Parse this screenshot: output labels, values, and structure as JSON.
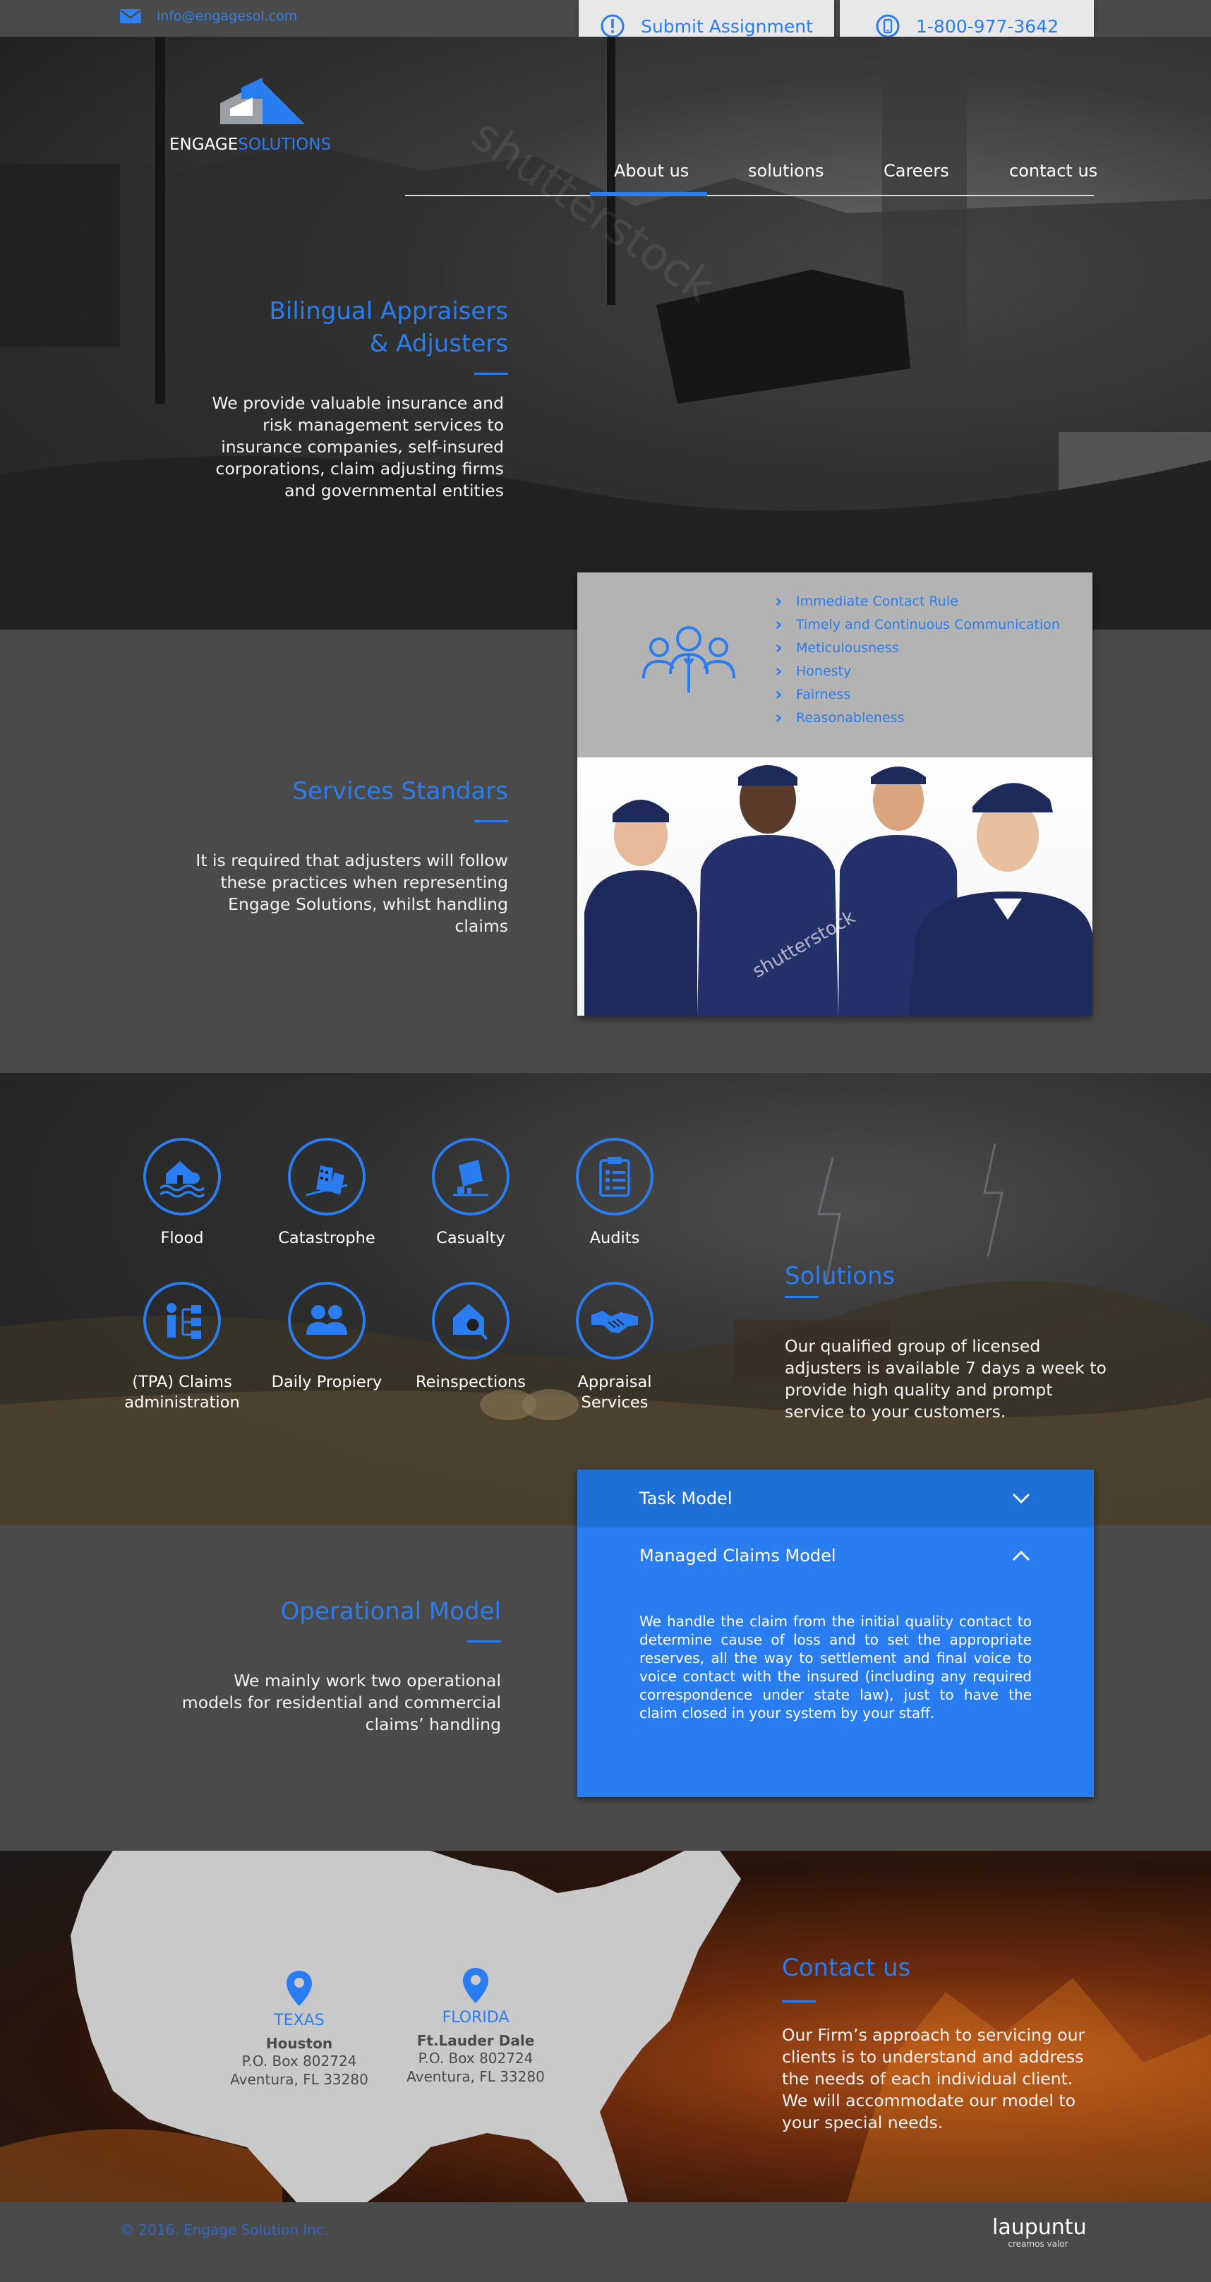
{
  "topbar": {
    "email": "info@engagesol.com",
    "submit_label": "Submit Assignment",
    "phone": "1-800-977-3642"
  },
  "brand": {
    "name_part1": "ENGAGE",
    "name_part2": "SOLUTIONS"
  },
  "nav": {
    "items": [
      {
        "label": "About us",
        "active": true
      },
      {
        "label": "solutions",
        "active": false
      },
      {
        "label": "Careers",
        "active": false
      },
      {
        "label": "contact us",
        "active": false
      }
    ]
  },
  "hero": {
    "title_line1": "Bilingual Appraisers",
    "title_line2": "& Adjusters",
    "body_lines": [
      "We provide valuable insurance and",
      "risk management services to",
      "insurance companies, self-insured",
      "corporations, claim adjusting firms",
      "and governmental entities"
    ],
    "watermark": "shutterstock"
  },
  "standards": {
    "title": "Services Standars",
    "body_lines": [
      "It is required that adjusters will follow",
      "these practices when representing",
      "Engage Solutions, whilst handling",
      "claims"
    ],
    "items": [
      "Immediate Contact Rule",
      "Timely and Continuous Communication",
      "Meticulousness",
      "Honesty",
      "Fairness",
      "Reasonableness"
    ],
    "icon": "team-icon",
    "photo_watermark": "shutterstock"
  },
  "solutions": {
    "title": "Solutions",
    "body_lines": [
      "Our qualified group of licensed",
      "adjusters is available 7 days a week to",
      "provide high quality and prompt",
      "service to your customers."
    ],
    "services": [
      {
        "label": "Flood",
        "icon": "flood-icon"
      },
      {
        "label": "Catastrophe",
        "icon": "catastrophe-icon"
      },
      {
        "label": "Casualty",
        "icon": "casualty-icon"
      },
      {
        "label": "Audits",
        "icon": "clipboard-icon"
      },
      {
        "label": "(TPA) Claims administration",
        "icon": "org-chart-icon"
      },
      {
        "label": "Daily Propiery",
        "icon": "users-icon"
      },
      {
        "label": "Reinspections",
        "icon": "house-search-icon"
      },
      {
        "label": "Appraisal Services",
        "icon": "handshake-icon"
      }
    ]
  },
  "operational": {
    "title": "Operational Model",
    "body_lines": [
      "We mainly work two operational",
      "models for residential and commercial",
      "claims’ handling"
    ],
    "accordion": {
      "task_label": "Task Model",
      "managed_label": "Managed Claims Model",
      "managed_body": "We handle the claim from the initial quality contact to determine cause of loss and to set the appropriate reserves, all the way to settlement and final voice to voice contact with the insured (including any required correspondence under state law), just to have the claim closed in your system by your staff."
    }
  },
  "contact": {
    "title": "Contact us",
    "body_lines": [
      "Our Firm’s approach to servicing our",
      "clients is to understand and address",
      "the needs of each individual client.",
      "We will accommodate our model to",
      "your special needs."
    ],
    "locations": [
      {
        "state": "TEXAS",
        "city": "Houston",
        "line1": "P.O. Box 802724",
        "line2": "Aventura, FL 33280"
      },
      {
        "state": "FLORIDA",
        "city": "Ft.Lauder Dale",
        "line1": "P.O. Box 802724",
        "line2": "Aventura, FL 33280"
      }
    ]
  },
  "footer": {
    "copyright": "© 2016.  Engage Solution Inc.",
    "credit_brand": "laupuntu",
    "credit_tagline": "creamos valor"
  },
  "colors": {
    "accent": "#2a7df0",
    "panel": "#4a4a4a",
    "card": "#b3b3b3"
  }
}
